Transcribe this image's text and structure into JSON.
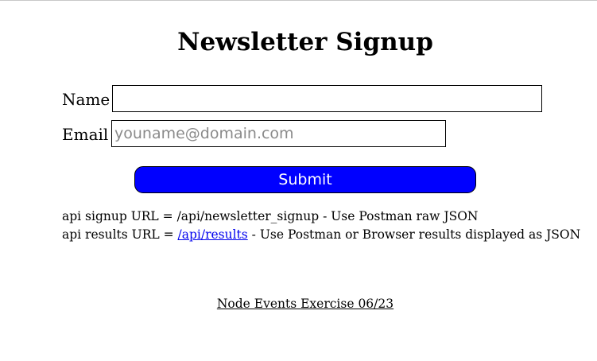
{
  "page": {
    "title": "Newsletter Signup"
  },
  "form": {
    "name_label": "Name",
    "name_value": "",
    "email_label": "Email",
    "email_placeholder": "youname@domain.com",
    "email_value": "",
    "submit_label": "Submit"
  },
  "info": {
    "signup_prefix": "api signup URL = /api/newsletter_signup - Use Postman raw JSON",
    "results_prefix": "api results URL = ",
    "results_link": "/api/results",
    "results_suffix": " - Use Postman or Browser results displayed as JSON"
  },
  "footer": {
    "text": "Node Events Exercise 06/23"
  },
  "colors": {
    "submit_bg": "#0000ff",
    "link": "#0000ee"
  }
}
